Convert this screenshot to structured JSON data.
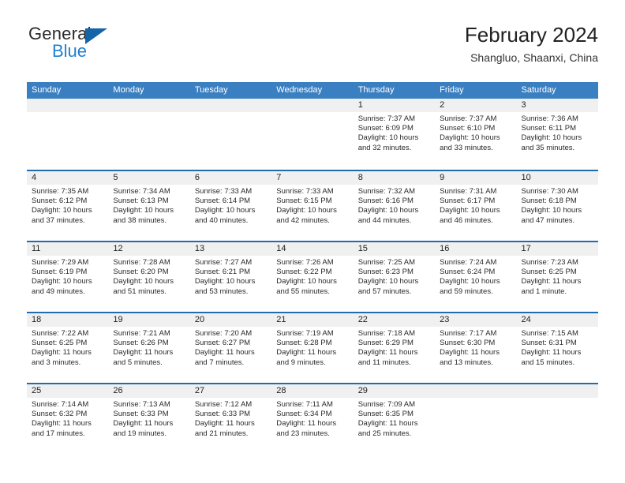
{
  "brand": {
    "word_general": "General",
    "word_blue": "Blue",
    "accent_color": "#1f7fd0",
    "triangle_color": "#1464aa"
  },
  "header": {
    "title": "February 2024",
    "subtitle": "Shangluo, Shaanxi, China"
  },
  "calendar": {
    "header_bg": "#3a7fc1",
    "row_divider_color": "#1f6cb0",
    "day_band_bg": "#f0f0f0",
    "weekdays": [
      "Sunday",
      "Monday",
      "Tuesday",
      "Wednesday",
      "Thursday",
      "Friday",
      "Saturday"
    ],
    "weeks": [
      [
        {
          "day": "",
          "sunrise": "",
          "sunset": "",
          "daylight1": "",
          "daylight2": ""
        },
        {
          "day": "",
          "sunrise": "",
          "sunset": "",
          "daylight1": "",
          "daylight2": ""
        },
        {
          "day": "",
          "sunrise": "",
          "sunset": "",
          "daylight1": "",
          "daylight2": ""
        },
        {
          "day": "",
          "sunrise": "",
          "sunset": "",
          "daylight1": "",
          "daylight2": ""
        },
        {
          "day": "1",
          "sunrise": "Sunrise: 7:37 AM",
          "sunset": "Sunset: 6:09 PM",
          "daylight1": "Daylight: 10 hours",
          "daylight2": "and 32 minutes."
        },
        {
          "day": "2",
          "sunrise": "Sunrise: 7:37 AM",
          "sunset": "Sunset: 6:10 PM",
          "daylight1": "Daylight: 10 hours",
          "daylight2": "and 33 minutes."
        },
        {
          "day": "3",
          "sunrise": "Sunrise: 7:36 AM",
          "sunset": "Sunset: 6:11 PM",
          "daylight1": "Daylight: 10 hours",
          "daylight2": "and 35 minutes."
        }
      ],
      [
        {
          "day": "4",
          "sunrise": "Sunrise: 7:35 AM",
          "sunset": "Sunset: 6:12 PM",
          "daylight1": "Daylight: 10 hours",
          "daylight2": "and 37 minutes."
        },
        {
          "day": "5",
          "sunrise": "Sunrise: 7:34 AM",
          "sunset": "Sunset: 6:13 PM",
          "daylight1": "Daylight: 10 hours",
          "daylight2": "and 38 minutes."
        },
        {
          "day": "6",
          "sunrise": "Sunrise: 7:33 AM",
          "sunset": "Sunset: 6:14 PM",
          "daylight1": "Daylight: 10 hours",
          "daylight2": "and 40 minutes."
        },
        {
          "day": "7",
          "sunrise": "Sunrise: 7:33 AM",
          "sunset": "Sunset: 6:15 PM",
          "daylight1": "Daylight: 10 hours",
          "daylight2": "and 42 minutes."
        },
        {
          "day": "8",
          "sunrise": "Sunrise: 7:32 AM",
          "sunset": "Sunset: 6:16 PM",
          "daylight1": "Daylight: 10 hours",
          "daylight2": "and 44 minutes."
        },
        {
          "day": "9",
          "sunrise": "Sunrise: 7:31 AM",
          "sunset": "Sunset: 6:17 PM",
          "daylight1": "Daylight: 10 hours",
          "daylight2": "and 46 minutes."
        },
        {
          "day": "10",
          "sunrise": "Sunrise: 7:30 AM",
          "sunset": "Sunset: 6:18 PM",
          "daylight1": "Daylight: 10 hours",
          "daylight2": "and 47 minutes."
        }
      ],
      [
        {
          "day": "11",
          "sunrise": "Sunrise: 7:29 AM",
          "sunset": "Sunset: 6:19 PM",
          "daylight1": "Daylight: 10 hours",
          "daylight2": "and 49 minutes."
        },
        {
          "day": "12",
          "sunrise": "Sunrise: 7:28 AM",
          "sunset": "Sunset: 6:20 PM",
          "daylight1": "Daylight: 10 hours",
          "daylight2": "and 51 minutes."
        },
        {
          "day": "13",
          "sunrise": "Sunrise: 7:27 AM",
          "sunset": "Sunset: 6:21 PM",
          "daylight1": "Daylight: 10 hours",
          "daylight2": "and 53 minutes."
        },
        {
          "day": "14",
          "sunrise": "Sunrise: 7:26 AM",
          "sunset": "Sunset: 6:22 PM",
          "daylight1": "Daylight: 10 hours",
          "daylight2": "and 55 minutes."
        },
        {
          "day": "15",
          "sunrise": "Sunrise: 7:25 AM",
          "sunset": "Sunset: 6:23 PM",
          "daylight1": "Daylight: 10 hours",
          "daylight2": "and 57 minutes."
        },
        {
          "day": "16",
          "sunrise": "Sunrise: 7:24 AM",
          "sunset": "Sunset: 6:24 PM",
          "daylight1": "Daylight: 10 hours",
          "daylight2": "and 59 minutes."
        },
        {
          "day": "17",
          "sunrise": "Sunrise: 7:23 AM",
          "sunset": "Sunset: 6:25 PM",
          "daylight1": "Daylight: 11 hours",
          "daylight2": "and 1 minute."
        }
      ],
      [
        {
          "day": "18",
          "sunrise": "Sunrise: 7:22 AM",
          "sunset": "Sunset: 6:25 PM",
          "daylight1": "Daylight: 11 hours",
          "daylight2": "and 3 minutes."
        },
        {
          "day": "19",
          "sunrise": "Sunrise: 7:21 AM",
          "sunset": "Sunset: 6:26 PM",
          "daylight1": "Daylight: 11 hours",
          "daylight2": "and 5 minutes."
        },
        {
          "day": "20",
          "sunrise": "Sunrise: 7:20 AM",
          "sunset": "Sunset: 6:27 PM",
          "daylight1": "Daylight: 11 hours",
          "daylight2": "and 7 minutes."
        },
        {
          "day": "21",
          "sunrise": "Sunrise: 7:19 AM",
          "sunset": "Sunset: 6:28 PM",
          "daylight1": "Daylight: 11 hours",
          "daylight2": "and 9 minutes."
        },
        {
          "day": "22",
          "sunrise": "Sunrise: 7:18 AM",
          "sunset": "Sunset: 6:29 PM",
          "daylight1": "Daylight: 11 hours",
          "daylight2": "and 11 minutes."
        },
        {
          "day": "23",
          "sunrise": "Sunrise: 7:17 AM",
          "sunset": "Sunset: 6:30 PM",
          "daylight1": "Daylight: 11 hours",
          "daylight2": "and 13 minutes."
        },
        {
          "day": "24",
          "sunrise": "Sunrise: 7:15 AM",
          "sunset": "Sunset: 6:31 PM",
          "daylight1": "Daylight: 11 hours",
          "daylight2": "and 15 minutes."
        }
      ],
      [
        {
          "day": "25",
          "sunrise": "Sunrise: 7:14 AM",
          "sunset": "Sunset: 6:32 PM",
          "daylight1": "Daylight: 11 hours",
          "daylight2": "and 17 minutes."
        },
        {
          "day": "26",
          "sunrise": "Sunrise: 7:13 AM",
          "sunset": "Sunset: 6:33 PM",
          "daylight1": "Daylight: 11 hours",
          "daylight2": "and 19 minutes."
        },
        {
          "day": "27",
          "sunrise": "Sunrise: 7:12 AM",
          "sunset": "Sunset: 6:33 PM",
          "daylight1": "Daylight: 11 hours",
          "daylight2": "and 21 minutes."
        },
        {
          "day": "28",
          "sunrise": "Sunrise: 7:11 AM",
          "sunset": "Sunset: 6:34 PM",
          "daylight1": "Daylight: 11 hours",
          "daylight2": "and 23 minutes."
        },
        {
          "day": "29",
          "sunrise": "Sunrise: 7:09 AM",
          "sunset": "Sunset: 6:35 PM",
          "daylight1": "Daylight: 11 hours",
          "daylight2": "and 25 minutes."
        },
        {
          "day": "",
          "sunrise": "",
          "sunset": "",
          "daylight1": "",
          "daylight2": ""
        },
        {
          "day": "",
          "sunrise": "",
          "sunset": "",
          "daylight1": "",
          "daylight2": ""
        }
      ]
    ]
  }
}
